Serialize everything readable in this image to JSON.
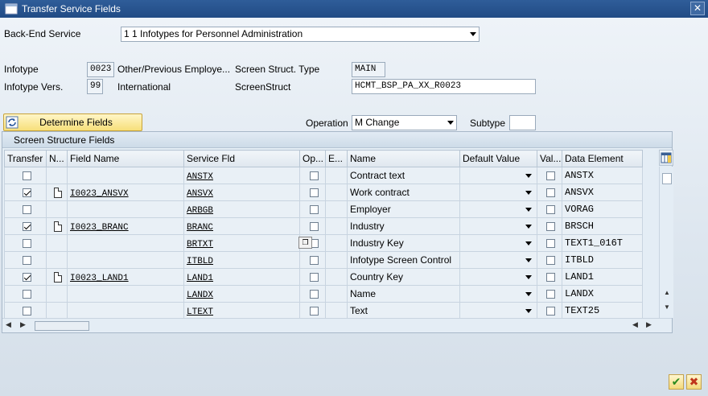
{
  "window": {
    "title": "Transfer Service Fields",
    "close_label": "✕"
  },
  "backend": {
    "label": "Back-End Service",
    "value": "1 1 Infotypes for Personnel Administration"
  },
  "infotype": {
    "label": "Infotype",
    "value": "0023",
    "desc": "Other/Previous Employe..."
  },
  "infotype_vers": {
    "label": "Infotype Vers.",
    "value": "99",
    "desc": "International"
  },
  "screen_struct_type": {
    "label": "Screen Struct. Type",
    "value": "MAIN"
  },
  "screen_struct": {
    "label": "ScreenStruct",
    "value": "HCMT_BSP_PA_XX_R0023"
  },
  "determine_button": {
    "label": "Determine Fields"
  },
  "operation": {
    "label": "Operation",
    "value": "M Change"
  },
  "subtype": {
    "label": "Subtype",
    "value": ""
  },
  "panel": {
    "title": "Screen Structure Fields"
  },
  "columns": {
    "transfer": "Transfer",
    "n": "N...",
    "field_name": "Field Name",
    "service_fld": "Service Fld",
    "op": "Op...",
    "e": "E...",
    "name": "Name",
    "default_value": "Default Value",
    "val": "Val...",
    "data_element": "Data Element"
  },
  "rows": [
    {
      "transfer": false,
      "field_name": "",
      "service_fld": "ANSTX",
      "name": "Contract text",
      "data_element": "ANSTX"
    },
    {
      "transfer": true,
      "field_name": "I0023_ANSVX",
      "service_fld": "ANSVX",
      "name": "Work contract",
      "data_element": "ANSVX"
    },
    {
      "transfer": false,
      "field_name": "",
      "service_fld": "ARBGB",
      "name": "Employer",
      "data_element": "VORAG"
    },
    {
      "transfer": true,
      "field_name": "I0023_BRANC",
      "service_fld": "BRANC",
      "name": "Industry",
      "data_element": "BRSCH"
    },
    {
      "transfer": false,
      "field_name": "",
      "service_fld": "BRTXT",
      "name": "Industry Key",
      "data_element": "TEXT1_016T"
    },
    {
      "transfer": false,
      "field_name": "",
      "service_fld": "ITBLD",
      "name": "Infotype Screen Control",
      "data_element": "ITBLD"
    },
    {
      "transfer": true,
      "field_name": "I0023_LAND1",
      "service_fld": "LAND1",
      "name": "Country Key",
      "data_element": "LAND1"
    },
    {
      "transfer": false,
      "field_name": "",
      "service_fld": "LANDX",
      "name": "Name",
      "data_element": "LANDX"
    },
    {
      "transfer": false,
      "field_name": "",
      "service_fld": "LTEXT",
      "name": "Text",
      "data_element": "TEXT25"
    }
  ],
  "icons": {
    "app": "window-icon",
    "determine": "refresh-icon",
    "doc": "document-icon",
    "column_settings": "column-settings-icon",
    "ok": "checkmark-icon",
    "cancel": "cancel-icon"
  },
  "colors": {
    "titlebar": "#214b85",
    "button_yellow": "#f7df7a",
    "ok_green": "#2a8a1f",
    "cancel_red": "#c0361c"
  }
}
